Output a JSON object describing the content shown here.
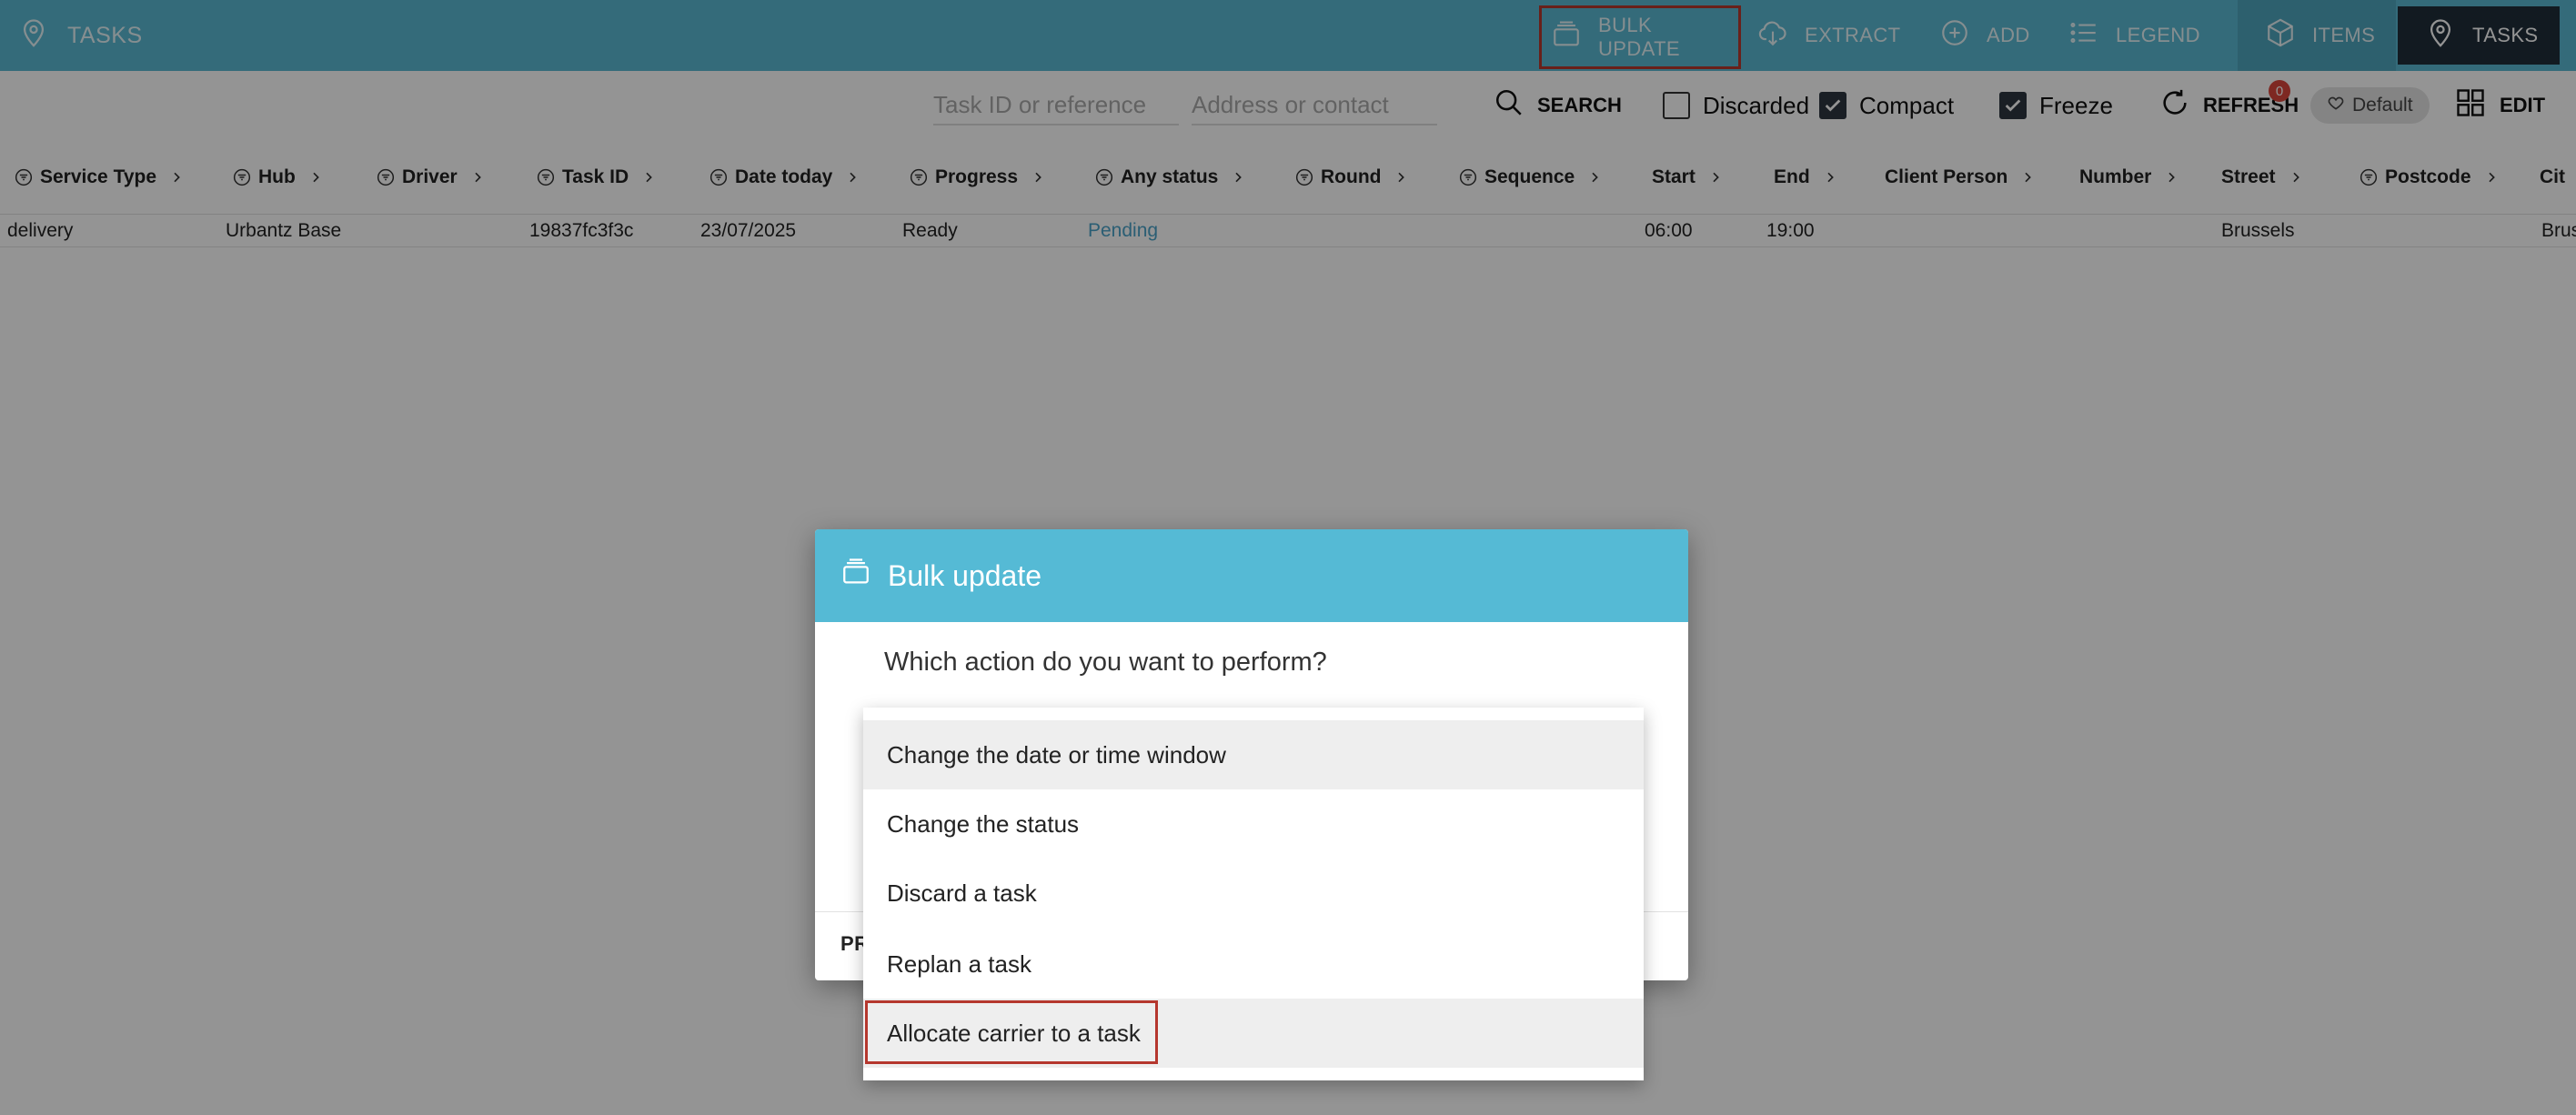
{
  "topbar": {
    "title": "TASKS",
    "buttons": {
      "bulk_update": "BULK UPDATE",
      "extract": "EXTRACT",
      "add": "ADD",
      "legend": "LEGEND",
      "items": "ITEMS",
      "tasks": "TASKS"
    }
  },
  "filters": {
    "task_placeholder": "Task ID or reference",
    "address_placeholder": "Address or contact",
    "search_label": "SEARCH",
    "discarded_label": "Discarded",
    "compact_label": "Compact",
    "freeze_label": "Freeze",
    "refresh_label": "REFRESH",
    "refresh_badge": "0",
    "view_label": "Default",
    "edit_label": "EDIT"
  },
  "table": {
    "columns": [
      "Service Type",
      "Hub",
      "Driver",
      "Task ID",
      "Date today",
      "Progress",
      "Any status",
      "Round",
      "Sequence",
      "Start",
      "End",
      "Client Person",
      "Number",
      "Street",
      "Postcode",
      "Cit"
    ],
    "rows": [
      {
        "service_type": "delivery",
        "hub": "Urbantz Base",
        "task_id": "19837fc3f3c",
        "date": "23/07/2025",
        "progress": "Ready",
        "status": "Pending",
        "start": "06:00",
        "end": "19:00",
        "street": "Brussels",
        "city": "Brus"
      }
    ]
  },
  "dialog": {
    "title": "Bulk update",
    "question": "Which action do you want to perform?",
    "footer_button": "PR"
  },
  "menu": {
    "items": [
      "Change the date or time window",
      "Change the status",
      "Discard a task",
      "Replan a task",
      "Allocate carrier to a task"
    ]
  },
  "colors": {
    "header_bg": "#5ab8d2",
    "dialog_header_bg": "#55bad5",
    "highlight_border": "#b5372e",
    "status_pending": "#4aa3c8"
  }
}
